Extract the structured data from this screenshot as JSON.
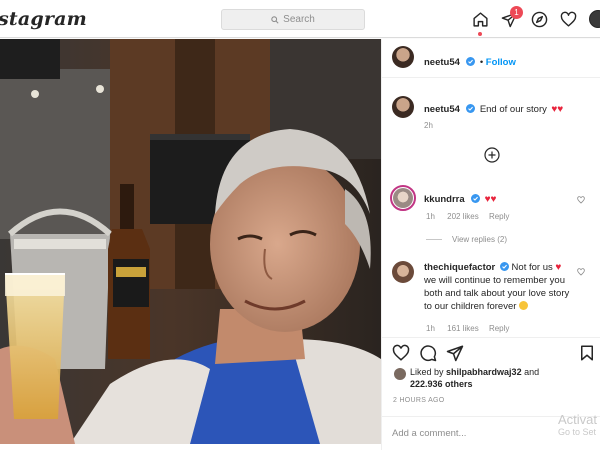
{
  "header": {
    "logo": "stagram",
    "search_placeholder": "Search",
    "notification_count": "1",
    "icons": [
      "home-icon",
      "direct-icon",
      "explore-icon",
      "activity-heart-icon",
      "profile-avatar"
    ]
  },
  "post": {
    "author": "neetu54",
    "follow_label": "Follow",
    "caption_user": "neetu54",
    "caption_text": "End of our story",
    "caption_time": "2h",
    "comments": [
      {
        "user": "kkundrra",
        "text": "",
        "time": "1h",
        "likes": "202 likes",
        "reply": "Reply",
        "view_replies": "View replies (2)"
      },
      {
        "user": "thechiquefactor",
        "text": "Not for us",
        "text_continued": "we will continue to remember you both and talk about your love story to our children forever",
        "time": "1h",
        "likes": "161 likes",
        "reply": "Reply"
      }
    ],
    "liked_by_prefix": "Liked by",
    "liked_by_user": "shilpabhardwaj32",
    "liked_by_and": "and",
    "others_count": "222.936 others",
    "timestamp": "2 HOURS AGO",
    "add_comment_placeholder": "Add a comment..."
  },
  "overlay": {
    "line1": "Activat",
    "line2": "Go to Set"
  },
  "colors": {
    "accent_blue": "#0095f6",
    "heart_red": "#ed4956",
    "border": "#dbdbdb"
  }
}
